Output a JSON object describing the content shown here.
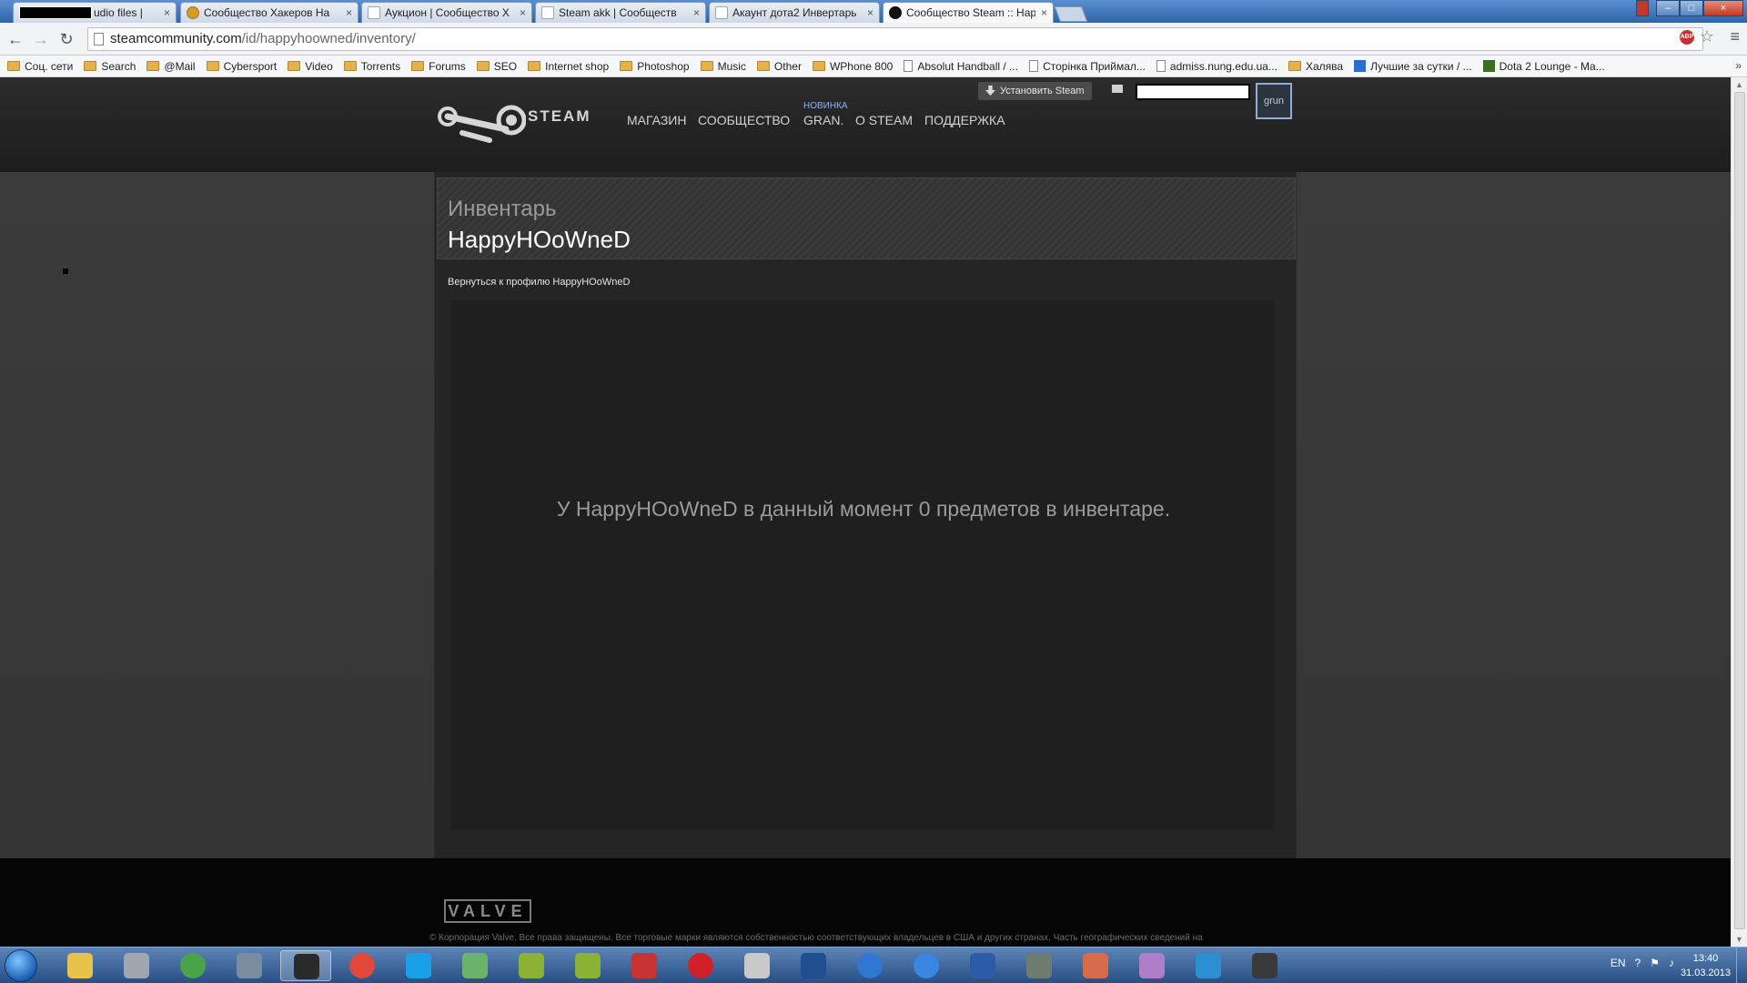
{
  "browser": {
    "tabs": [
      {
        "title": "udio files |",
        "redacted": true,
        "active": false
      },
      {
        "title": "Сообщество Хакеров На",
        "active": false
      },
      {
        "title": "Аукцион | Сообщество Х",
        "active": false
      },
      {
        "title": "Steam akk | Сообществ",
        "active": false
      },
      {
        "title": "Акаунт дота2 Инвертарь",
        "active": false
      },
      {
        "title": "Сообщество Steam :: Hap",
        "active": true
      }
    ],
    "tab_close": "×",
    "url_host": "steamcommunity.com",
    "url_path": "/id/happyhoowned/inventory/",
    "back_glyph": "←",
    "forward_glyph": "→",
    "reload_glyph": "↻",
    "abp_label": "ABP",
    "star_glyph": "☆",
    "menu_glyph": "≡",
    "bookmarks": [
      {
        "label": "Соц. сети",
        "icon": "folder-icon"
      },
      {
        "label": "Search",
        "icon": "folder-icon"
      },
      {
        "label": "@Mail",
        "icon": "folder-icon"
      },
      {
        "label": "Cybersport",
        "icon": "folder-icon"
      },
      {
        "label": "Video",
        "icon": "folder-icon"
      },
      {
        "label": "Torrents",
        "icon": "folder-icon"
      },
      {
        "label": "Forums",
        "icon": "folder-icon"
      },
      {
        "label": "SEO",
        "icon": "folder-icon"
      },
      {
        "label": "Internet shop",
        "icon": "folder-icon"
      },
      {
        "label": "Photoshop",
        "icon": "folder-icon"
      },
      {
        "label": "Music",
        "icon": "folder-icon"
      },
      {
        "label": "Other",
        "icon": "folder-icon"
      },
      {
        "label": "WPhone 800",
        "icon": "folder-icon"
      },
      {
        "label": "Absolut Handball / ...",
        "icon": "page-icon"
      },
      {
        "label": "Сторінка Приймал...",
        "icon": "page-icon"
      },
      {
        "label": "admiss.nung.edu.ua...",
        "icon": "page-icon"
      },
      {
        "label": "Халява",
        "icon": "folder-icon"
      },
      {
        "label": "Лучшие за сутки / ...",
        "icon": "nung-icon"
      },
      {
        "label": "Dota 2 Lounge - Ma...",
        "icon": "dota-icon"
      }
    ],
    "bookmarks_more": "»"
  },
  "steam": {
    "logo_word": "STEAM",
    "logo_tm": "®",
    "nav": [
      {
        "label": "МАГАЗИН"
      },
      {
        "label": "СООБЩЕСТВО"
      },
      {
        "label": "GRAN.",
        "badge": "НОВИНКА"
      },
      {
        "label": "О STEAM"
      },
      {
        "label": "ПОДДЕРЖКА"
      }
    ],
    "install_label": "Установить Steam",
    "avatar_text": "grun",
    "section_label": "Инвентарь",
    "owner_name": "HappyHOoWneD",
    "back_link": "Вернуться к профилю HappyHOoWneD",
    "empty_message": "У HappyHOoWneD в данный момент 0 предметов в инвентаре.",
    "footer_logo": "VALVE",
    "copyright": "© Корпорация Valve. Все права защищены. Все торговые марки являются собственностью соответствующих владельцев в США и других странах. Часть географических сведений на"
  },
  "taskbar": {
    "lang": "EN",
    "time": "13:40",
    "date": "31.03.2013",
    "apps": [
      "explorer",
      "media",
      "utorrent",
      "skype-audio",
      "steam",
      "chrome",
      "skype",
      "network",
      "qip",
      "qip2",
      "red-app",
      "opera",
      "game",
      "photoshop",
      "moon",
      "thunder",
      "word",
      "eye",
      "star",
      "notepad",
      "player",
      "settings"
    ],
    "colors": {
      "explorer": "#e8c24a",
      "media": "#a0a6ad",
      "utorrent": "#4aa34a",
      "skype-audio": "#7a8da0",
      "steam": "#2a2a2a",
      "chrome": "#e0493a",
      "skype": "#1aa0e8",
      "network": "#6bb26b",
      "qip": "#8bb235",
      "qip2": "#8bb235",
      "red-app": "#c83232",
      "opera": "#d2202a",
      "game": "#c9c9c9",
      "photoshop": "#1f4f8f",
      "moon": "#2f77d2",
      "thunder": "#3a86e0",
      "word": "#2c5ca8",
      "eye": "#6f7c6f",
      "star": "#d86b4a",
      "notepad": "#b07ec9",
      "player": "#2d8fd2",
      "settings": "#3a3a3a"
    }
  }
}
